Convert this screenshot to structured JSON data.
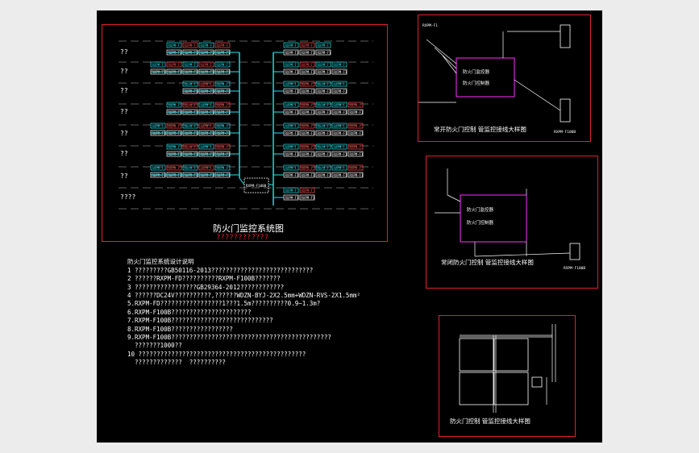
{
  "main_diagram": {
    "title": "防火门监控系统图",
    "subtitle": "????????????",
    "floor_labels": [
      "??",
      "??",
      "??",
      "??",
      "??",
      "??",
      "??",
      "????"
    ],
    "device_label_a": "RXPM-F",
    "device_label_b": "RXPM-F1",
    "controller_label": "RXPM-F100B"
  },
  "detail_1": {
    "title": "常开防火门控制 管监控接线大样图",
    "label_left": "RXPM-F1",
    "label_right": "RXPM-F100B",
    "box_line1": "防火门监控器",
    "box_line2": "防火门控制器"
  },
  "detail_2": {
    "title": "常闭防火门控制 管监控接线大样图",
    "box_line1": "防火门监控器",
    "box_line2": "防火门控制器",
    "label_right": "RXPM-F100B"
  },
  "detail_3": {
    "title": "防火门控制 管监控接线大样图"
  },
  "notes": {
    "heading": "防火门监控系统设计说明",
    "lines": [
      "1 ?????????GB50116-2013????????????????????????????",
      "2 ??????RXPM-FD??????????RXPM-F100B???????",
      "3 ?????????????????GB29364-2012????????????",
      "4 ??????DC24V??????????,??????WDZN-BYJ-2X2.5mm+WDZN-RVS-2X1.5mm²",
      "5.RXPM-FD?????????????????1???1.5m??????????0.9~1.3m?",
      "6.RXPM-F100B??????????????????????",
      "7.RXPM-F100B????????????????????????????",
      "8.RXPM-F100B?????????????????",
      "9.RXPM-F100B????????????????????????????????????????????",
      "  ???????1000??",
      "10 ??????????????????????????????????????????????",
      "  ?????????????  ??????????"
    ]
  },
  "colors": {
    "frame": "#e0202a",
    "cyan": "#22e6f0",
    "white": "#ffffff",
    "magenta": "#ff30ff",
    "background": "#000000",
    "outer": "#ececec"
  }
}
